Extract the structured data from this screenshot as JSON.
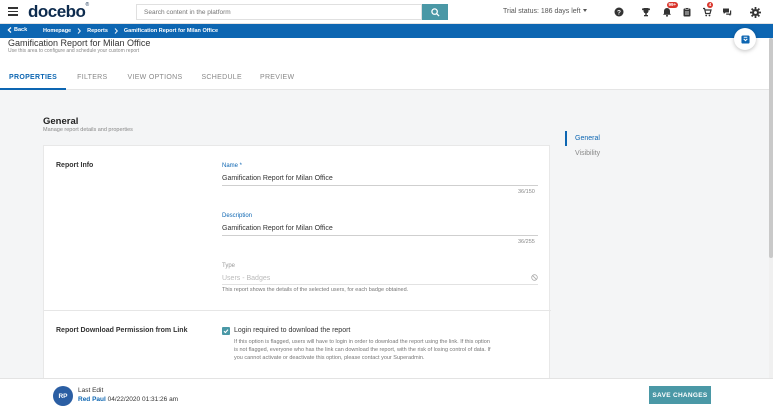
{
  "topbar": {
    "logo": "docebo",
    "logo_mark": "®",
    "search_placeholder": "Search content in the platform",
    "trial_status": "Trial status: 186 days left",
    "notification_badge": "99+",
    "cart_badge": "4"
  },
  "breadcrumb": {
    "back_label": "Back",
    "items": [
      "Homepage",
      "Reports",
      "Gamification Report for Milan Office"
    ]
  },
  "header": {
    "title": "Gamification Report for Milan Office",
    "subtitle": "Use this area to configure and schedule your custom report",
    "tabs": [
      "PROPERTIES",
      "FILTERS",
      "VIEW OPTIONS",
      "SCHEDULE",
      "PREVIEW"
    ],
    "active_tab": "PROPERTIES"
  },
  "section": {
    "title": "General",
    "subtitle": "Manage report details and properties"
  },
  "report_info": {
    "label": "Report Info",
    "name_label": "Name *",
    "name_value": "Gamification Report for Milan Office",
    "name_counter": "36/150",
    "description_label": "Description",
    "description_value": "Gamification Report for Milan Office",
    "description_counter": "36/255",
    "type_label": "Type",
    "type_value": "Users - Badges",
    "type_help": "This report shows the details of the selected users, for each badge obtained."
  },
  "download_permission": {
    "label": "Report Download Permission from Link",
    "checkbox_label": "Login required to download the report",
    "checked": true,
    "help_line1": "If this option is flagged, users will have to login in order to download the report using the link. If this option",
    "help_line2": "is not flagged, everyone who has the link can download the report, with the risk of losing control of data. If",
    "help_line3": "you cannot activate or deactivate this option, please contact your Superadmin."
  },
  "right_nav": {
    "items": [
      "General",
      "Visibility"
    ],
    "active": "General"
  },
  "footer": {
    "avatar_initials": "RP",
    "last_edit_label": "Last Edit",
    "editor_name": "Red Paul",
    "edit_timestamp": "04/22/2020 01:31:26 am",
    "save_label": "SAVE CHANGES"
  },
  "colors": {
    "brand_blue": "#0d66b2",
    "accent_teal": "#4a98a6",
    "badge_red": "#d9342b",
    "logo_navy": "#0d2b4e"
  }
}
